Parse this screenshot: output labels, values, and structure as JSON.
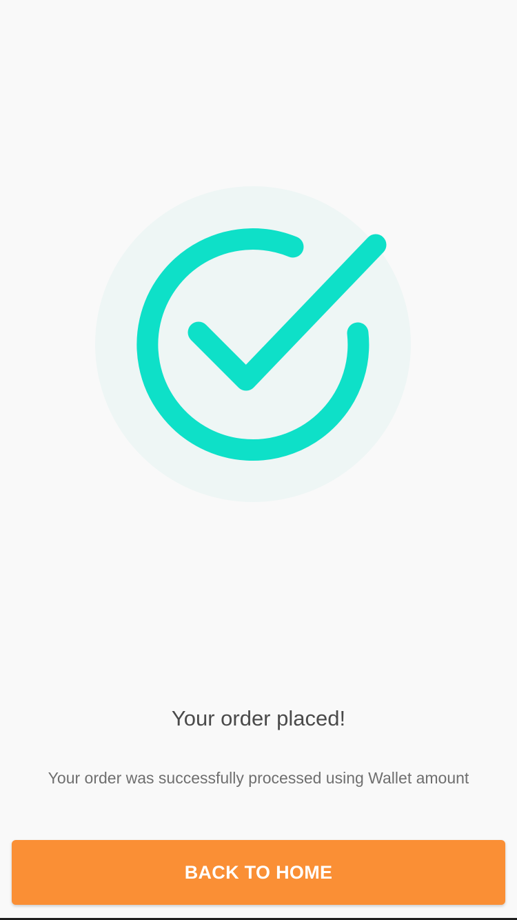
{
  "success": {
    "icon": "check-circle-icon",
    "icon_color": "#0ee0c8",
    "halo_color": "#eef6f5"
  },
  "title": "Your order placed!",
  "message": "Your order was successfully processed using Wallet amount",
  "home_button": {
    "label": "BACK TO HOME",
    "color": "#fa8f35"
  }
}
